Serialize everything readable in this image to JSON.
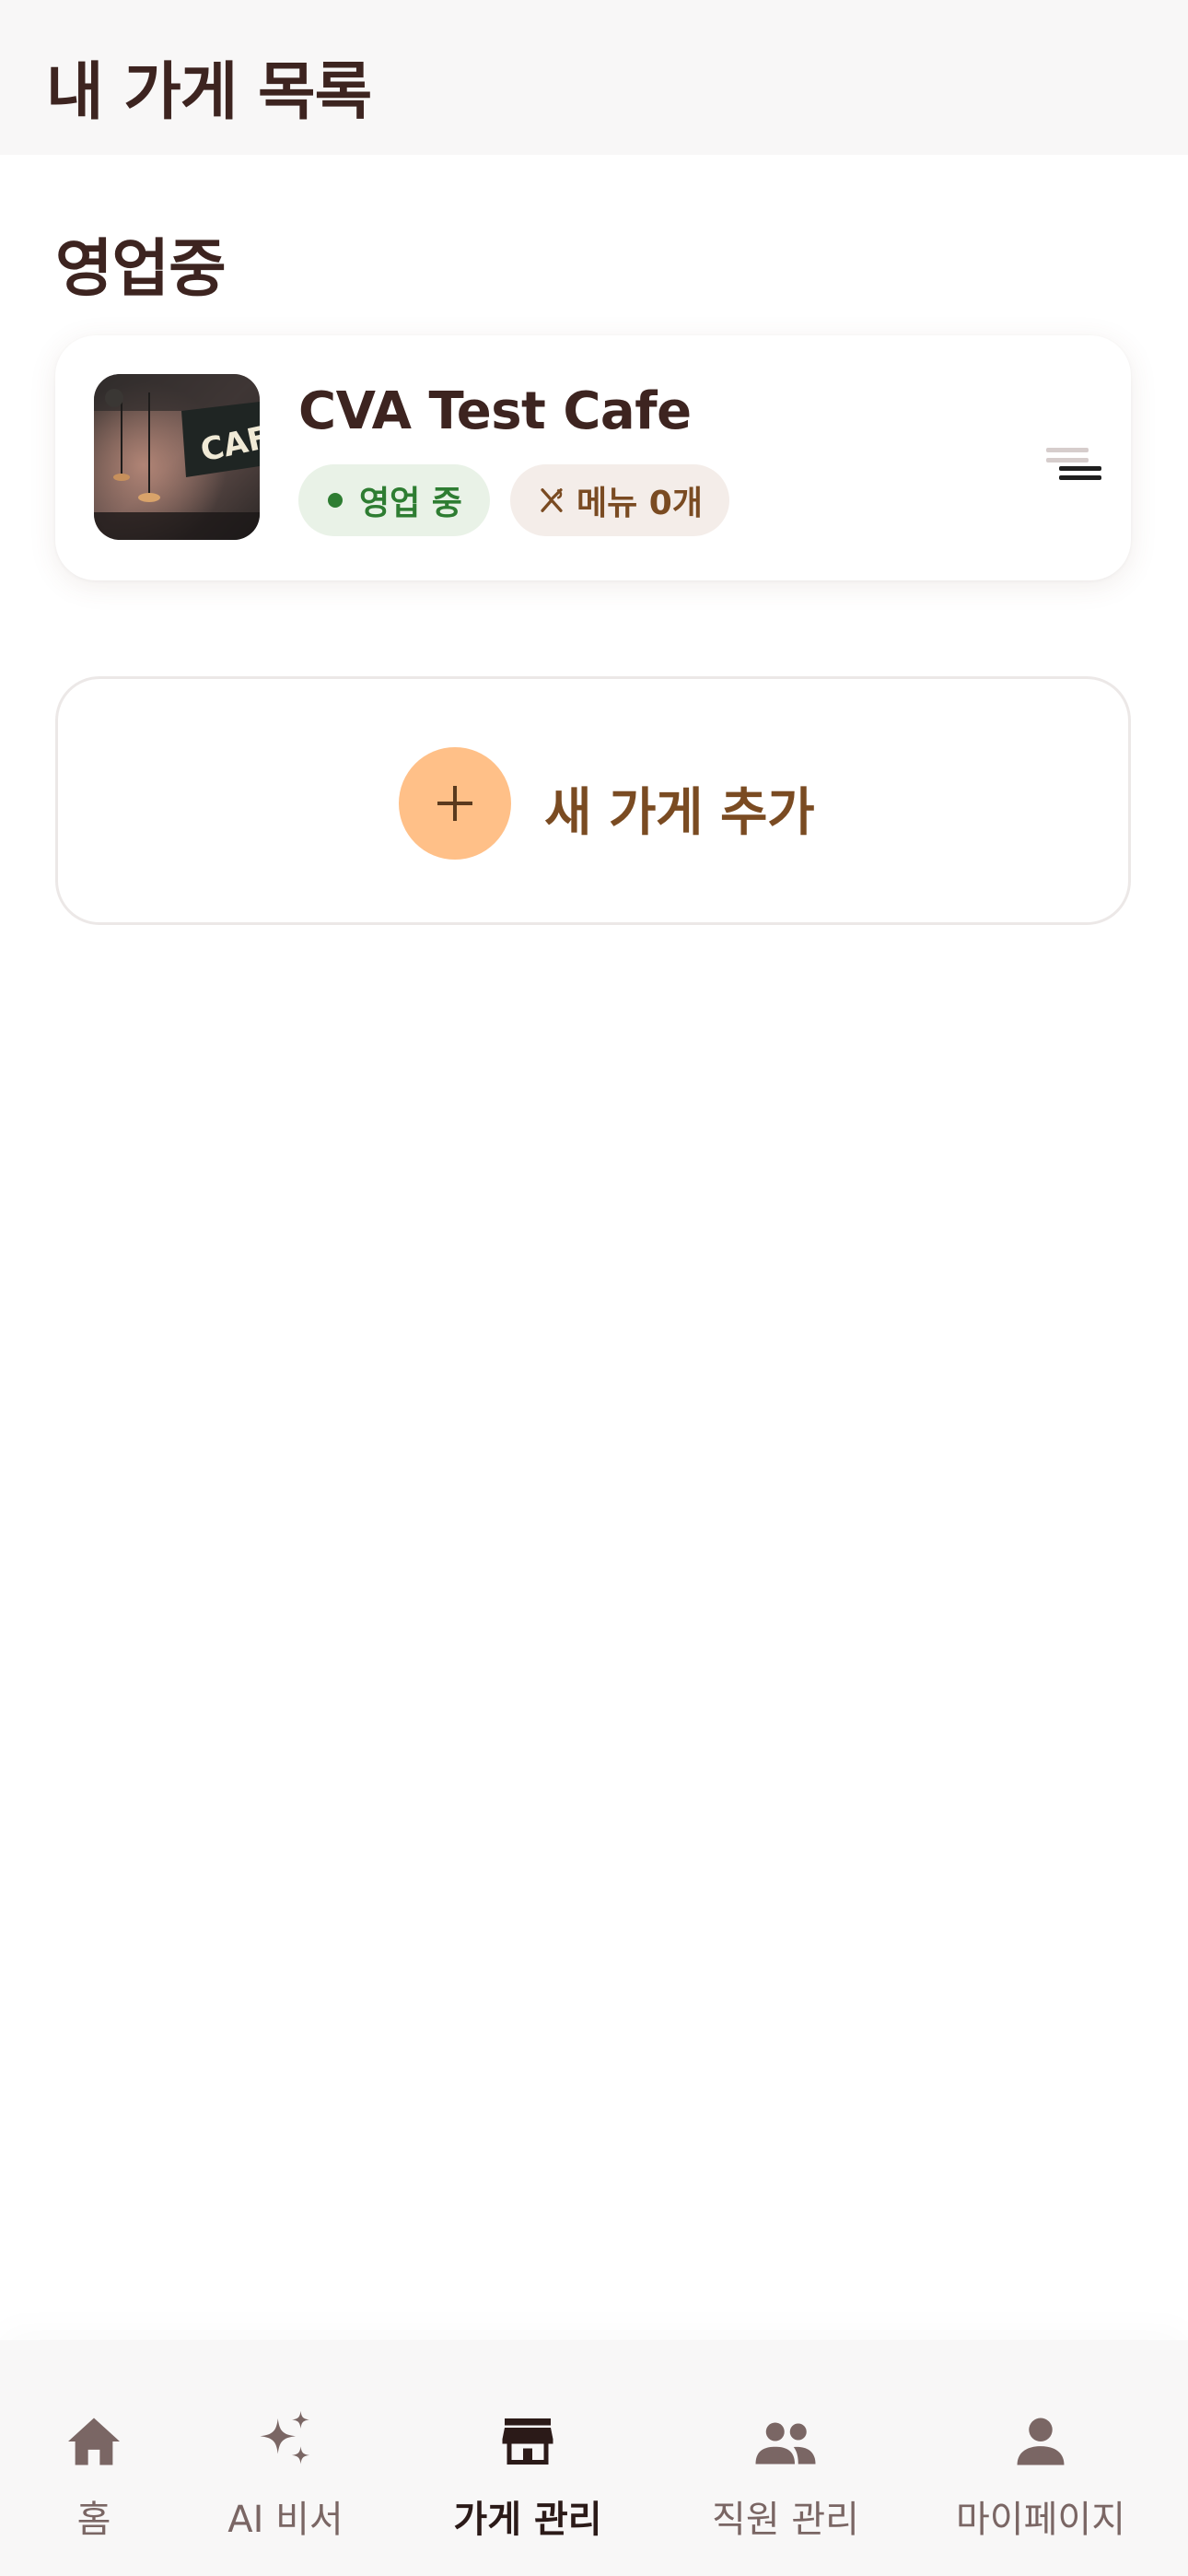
{
  "header": {
    "title": "내 가게 목록"
  },
  "section": {
    "title": "영업중"
  },
  "store": {
    "name": "CVA Test Cafe",
    "status": "영업 중",
    "menu_count": "메뉴 0개",
    "thumbnail_icon": "cafe-photo",
    "thumbnail_sign": "CAFE",
    "status_color": "#2e7d32"
  },
  "add_store": {
    "label": "새 가게 추가",
    "icon": "plus-icon",
    "accent": "#ffc088"
  },
  "nav": {
    "items": [
      {
        "label": "홈",
        "icon": "home-icon"
      },
      {
        "label": "AI 비서",
        "icon": "sparkle-icon"
      },
      {
        "label": "가게 관리",
        "icon": "store-icon",
        "active": true
      },
      {
        "label": "직원 관리",
        "icon": "people-icon"
      },
      {
        "label": "마이페이지",
        "icon": "person-icon"
      }
    ]
  },
  "colors": {
    "text": "#3d2420",
    "brown": "#7a4b22",
    "bar_bg": "#f8f7f7"
  }
}
